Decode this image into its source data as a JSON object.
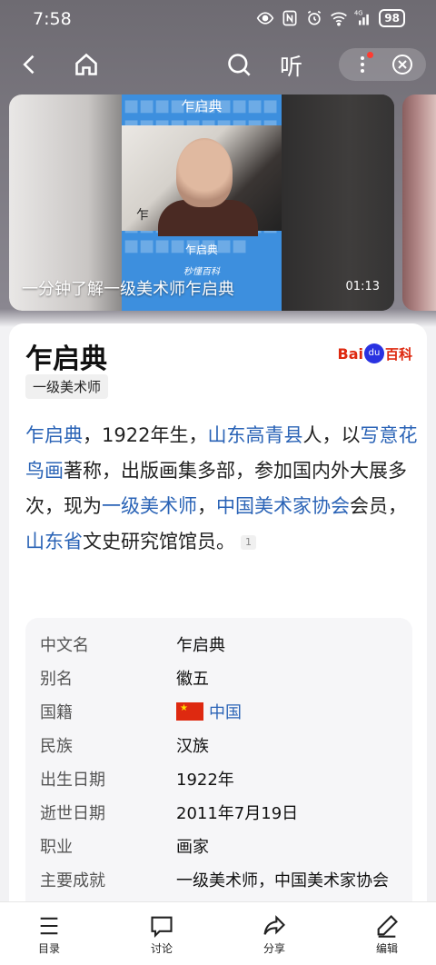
{
  "status_bar": {
    "time": "7:58",
    "battery": "98",
    "network": "4G"
  },
  "top_nav": {
    "listen_label": "听"
  },
  "video": {
    "top_text": "乍启典",
    "small_name": "乍启典",
    "logo_text": "秒懂百科",
    "signature": "乍",
    "caption": "一分钟了解一级美术师乍启典",
    "duration": "01:13"
  },
  "entry": {
    "title": "乍启典",
    "tag": "一级美术师",
    "logo": {
      "bai": "Bai",
      "du": "du",
      "baike": "百科"
    },
    "summary": [
      {
        "text": "乍启典",
        "link": true
      },
      {
        "text": "，1922年生，",
        "link": false
      },
      {
        "text": "山东高青县",
        "link": true
      },
      {
        "text": "人，以",
        "link": false
      },
      {
        "text": "写意花鸟画",
        "link": true
      },
      {
        "text": "著称，出版画集多部，参加国内外大展多次，现为",
        "link": false
      },
      {
        "text": "一级美术师",
        "link": true
      },
      {
        "text": "，",
        "link": false
      },
      {
        "text": "中国美术家协会",
        "link": true
      },
      {
        "text": "会员，",
        "link": false
      },
      {
        "text": "山东省",
        "link": true
      },
      {
        "text": "文史研究馆馆员。",
        "link": false
      }
    ],
    "ref_mark": "1"
  },
  "info": [
    {
      "key": "中文名",
      "value": "乍启典"
    },
    {
      "key": "别名",
      "value": "徽五"
    },
    {
      "key": "国籍",
      "value": "中国",
      "link": true,
      "flag": true
    },
    {
      "key": "民族",
      "value": "汉族"
    },
    {
      "key": "出生日期",
      "value": "1922年"
    },
    {
      "key": "逝世日期",
      "value": "2011年7月19日"
    },
    {
      "key": "职业",
      "value": "画家"
    },
    {
      "key": "主要成就",
      "value": "一级美术师，中国美术家协会"
    }
  ],
  "bottom_bar": {
    "toc": "目录",
    "discuss": "讨论",
    "share": "分享",
    "edit": "编辑"
  }
}
